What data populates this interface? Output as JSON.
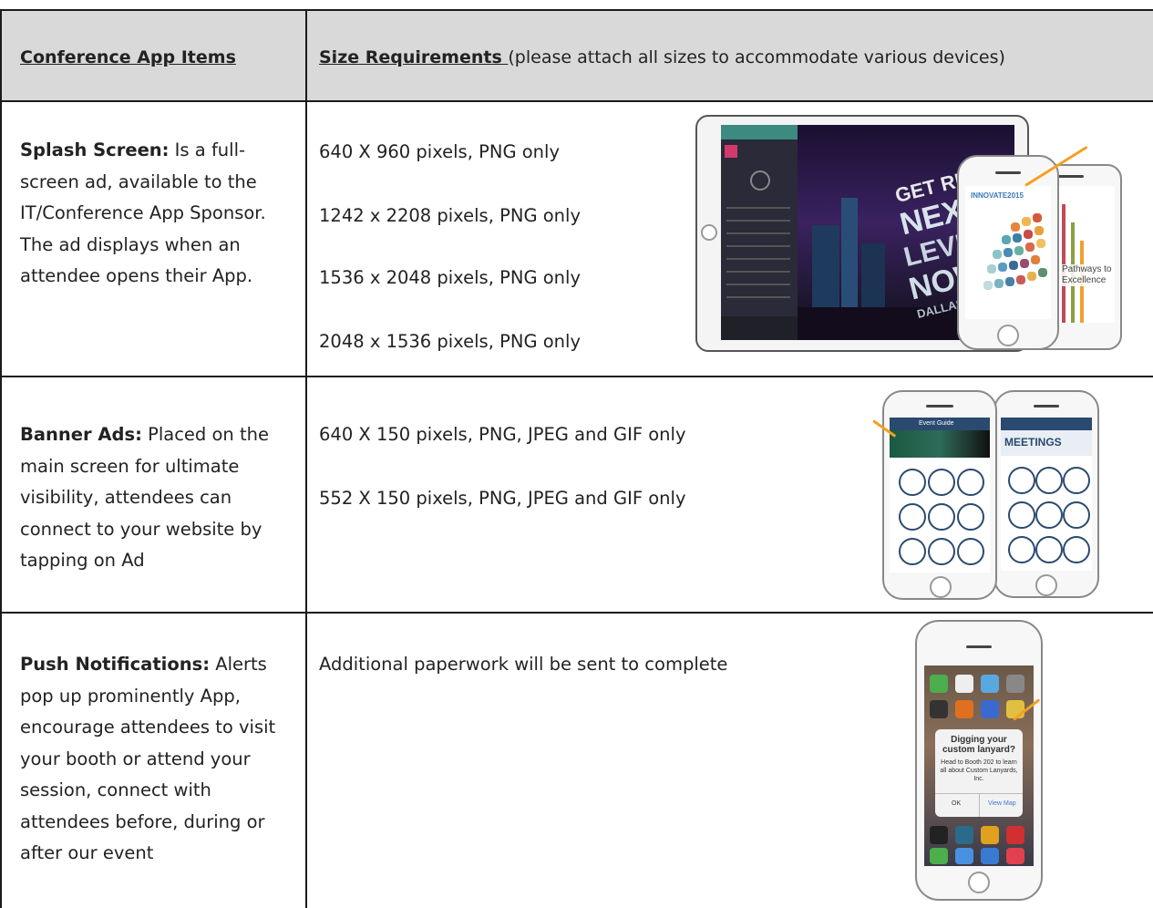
{
  "header": {
    "col1": "Conference App Items",
    "col2_bold": "Size Requirements ",
    "col2_rest": "(please attach all sizes to accommodate various devices)"
  },
  "rows": [
    {
      "title": "Splash Screen:",
      "desc": " Is a full-screen ad, available to the IT/Conference App Sponsor. The ad displays when an attendee opens their App.",
      "sizes": [
        "640 X 960 pixels, PNG only",
        "1242 x 2208 pixels, PNG only",
        "1536 x 2048 pixels, PNG only",
        "2048 x 1536 pixels, PNG only"
      ],
      "image_text": {
        "headline": [
          "GET REAL",
          "NEXT",
          "LEVEL",
          "NOW",
          "DALLAS 2015"
        ],
        "phone_brand": "INNOVATE2015",
        "phone2_text": "Pathways to Excellence"
      }
    },
    {
      "title": "Banner Ads:",
      "desc": " Placed on the main screen for ultimate visibility, attendees can connect to your website by tapping on Ad",
      "sizes": [
        "640 X 150 pixels, PNG, JPEG and GIF only",
        "552 X 150 pixels, PNG, JPEG and GIF only"
      ],
      "image_text": {
        "screen_title": "Event Guide",
        "banner2": "MEETINGS"
      }
    },
    {
      "title": "Push Notifications:",
      "desc": " Alerts pop up prominently App, encourage attendees to visit your booth or attend your session, connect with attendees before, during or after our event",
      "sizes": [
        "Additional paperwork will be sent to complete"
      ],
      "image_text": {
        "alert_title": "Digging your custom lanyard?",
        "alert_body": "Head to Booth 202 to learn all about Custom Lanyards, Inc.",
        "ok": "OK",
        "view_map": "View Map"
      }
    }
  ],
  "colors": {
    "header_bg": "#d9d9d9",
    "rule": "#1a1a1a",
    "accent_arrow": "#f5a020",
    "icon_blue": "#2a4a70"
  }
}
